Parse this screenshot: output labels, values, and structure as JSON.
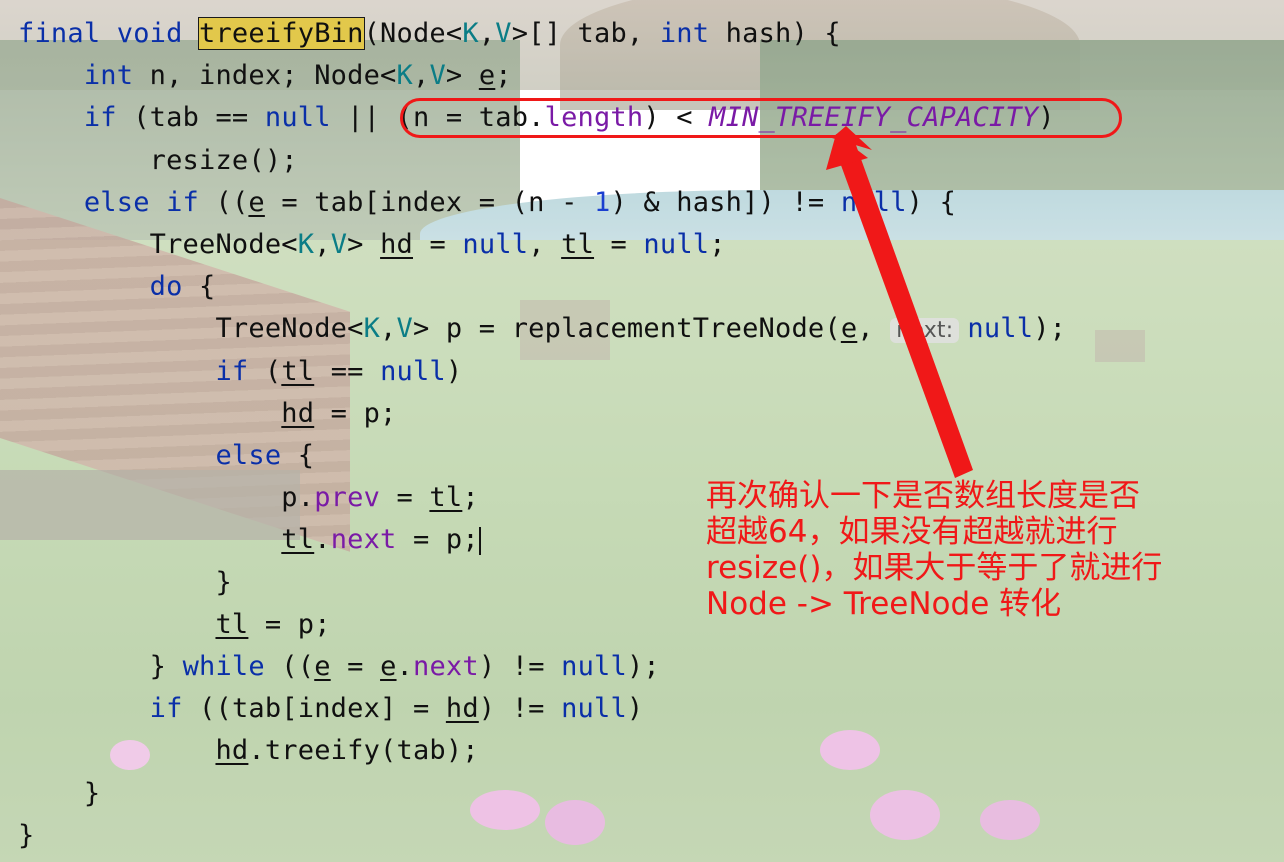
{
  "code": {
    "lines": [
      {
        "segments": [
          {
            "t": "final ",
            "c": "kw"
          },
          {
            "t": "void ",
            "c": "kw"
          },
          {
            "t": "treeifyBin",
            "c": "hl"
          },
          {
            "t": "(Node<"
          },
          {
            "t": "K",
            "c": "tp"
          },
          {
            "t": ","
          },
          {
            "t": "V",
            "c": "tp"
          },
          {
            "t": ">[] tab, "
          },
          {
            "t": "int ",
            "c": "kw"
          },
          {
            "t": "hash) {"
          }
        ]
      },
      {
        "segments": [
          {
            "t": "    "
          },
          {
            "t": "int ",
            "c": "kw"
          },
          {
            "t": "n, index; Node<"
          },
          {
            "t": "K",
            "c": "tp"
          },
          {
            "t": ","
          },
          {
            "t": "V",
            "c": "tp"
          },
          {
            "t": "> "
          },
          {
            "t": "e",
            "c": "ul"
          },
          {
            "t": ";"
          }
        ]
      },
      {
        "segments": [
          {
            "t": "    "
          },
          {
            "t": "if ",
            "c": "kw"
          },
          {
            "t": "(tab == "
          },
          {
            "t": "null ",
            "c": "kw"
          },
          {
            "t": "|| (n = tab."
          },
          {
            "t": "length",
            "c": "fld"
          },
          {
            "t": ") < "
          },
          {
            "t": "MIN_TREEIFY_CAPACITY",
            "c": "cst"
          },
          {
            "t": ")"
          }
        ]
      },
      {
        "segments": [
          {
            "t": "        resize();"
          }
        ]
      },
      {
        "segments": [
          {
            "t": "    "
          },
          {
            "t": "else if ",
            "c": "kw"
          },
          {
            "t": "(("
          },
          {
            "t": "e",
            "c": "ul"
          },
          {
            "t": " = tab[index = (n - "
          },
          {
            "t": "1",
            "c": "num"
          },
          {
            "t": ") & hash]) != "
          },
          {
            "t": "null",
            "c": "kw"
          },
          {
            "t": ") {"
          }
        ]
      },
      {
        "segments": [
          {
            "t": "        TreeNode<"
          },
          {
            "t": "K",
            "c": "tp"
          },
          {
            "t": ","
          },
          {
            "t": "V",
            "c": "tp"
          },
          {
            "t": "> "
          },
          {
            "t": "hd",
            "c": "ul"
          },
          {
            "t": " = "
          },
          {
            "t": "null",
            "c": "kw"
          },
          {
            "t": ", "
          },
          {
            "t": "tl",
            "c": "ul"
          },
          {
            "t": " = "
          },
          {
            "t": "null",
            "c": "kw"
          },
          {
            "t": ";"
          }
        ]
      },
      {
        "segments": [
          {
            "t": "        "
          },
          {
            "t": "do ",
            "c": "kw"
          },
          {
            "t": "{"
          }
        ]
      },
      {
        "segments": [
          {
            "t": "            TreeNode<"
          },
          {
            "t": "K",
            "c": "tp"
          },
          {
            "t": ","
          },
          {
            "t": "V",
            "c": "tp"
          },
          {
            "t": "> p = replacementTreeNode("
          },
          {
            "t": "e",
            "c": "ul"
          },
          {
            "t": ", "
          },
          {
            "t": "next:",
            "c": "hint"
          },
          {
            "t": "null",
            "c": "kw"
          },
          {
            "t": ");"
          }
        ]
      },
      {
        "segments": [
          {
            "t": "            "
          },
          {
            "t": "if ",
            "c": "kw"
          },
          {
            "t": "("
          },
          {
            "t": "tl",
            "c": "ul"
          },
          {
            "t": " == "
          },
          {
            "t": "null",
            "c": "kw"
          },
          {
            "t": ")"
          }
        ]
      },
      {
        "segments": [
          {
            "t": "                "
          },
          {
            "t": "hd",
            "c": "ul"
          },
          {
            "t": " = p;"
          }
        ]
      },
      {
        "segments": [
          {
            "t": "            "
          },
          {
            "t": "else ",
            "c": "kw"
          },
          {
            "t": "{"
          }
        ]
      },
      {
        "segments": [
          {
            "t": "                p."
          },
          {
            "t": "prev",
            "c": "fld"
          },
          {
            "t": " = "
          },
          {
            "t": "tl",
            "c": "ul"
          },
          {
            "t": ";"
          }
        ]
      },
      {
        "segments": [
          {
            "t": "                "
          },
          {
            "t": "tl",
            "c": "ul"
          },
          {
            "t": "."
          },
          {
            "t": "next",
            "c": "fld"
          },
          {
            "t": " = p;"
          },
          {
            "t": "",
            "c": "caret"
          }
        ]
      },
      {
        "segments": [
          {
            "t": "            }"
          }
        ]
      },
      {
        "segments": [
          {
            "t": "            "
          },
          {
            "t": "tl",
            "c": "ul"
          },
          {
            "t": " = p;"
          }
        ]
      },
      {
        "segments": [
          {
            "t": "        } "
          },
          {
            "t": "while ",
            "c": "kw"
          },
          {
            "t": "(("
          },
          {
            "t": "e",
            "c": "ul"
          },
          {
            "t": " = "
          },
          {
            "t": "e",
            "c": "ul"
          },
          {
            "t": "."
          },
          {
            "t": "next",
            "c": "fld"
          },
          {
            "t": ") != "
          },
          {
            "t": "null",
            "c": "kw"
          },
          {
            "t": ");"
          }
        ]
      },
      {
        "segments": [
          {
            "t": "        "
          },
          {
            "t": "if ",
            "c": "kw"
          },
          {
            "t": "((tab[index] = "
          },
          {
            "t": "hd",
            "c": "ul"
          },
          {
            "t": ") != "
          },
          {
            "t": "null",
            "c": "kw"
          },
          {
            "t": ")"
          }
        ]
      },
      {
        "segments": [
          {
            "t": "            "
          },
          {
            "t": "hd",
            "c": "ul"
          },
          {
            "t": ".treeify(tab);"
          }
        ]
      },
      {
        "segments": [
          {
            "t": "    }"
          }
        ]
      },
      {
        "segments": [
          {
            "t": "}"
          }
        ]
      }
    ]
  },
  "annotation": {
    "lines": [
      "再次确认一下是否数组长度是否",
      "超越64，如果没有超越就进行",
      "resize()，如果大于等于了就进行",
      "Node -> TreeNode 转化"
    ],
    "color": "#f01818"
  },
  "colors": {
    "keyword": "#0a2fa8",
    "type_param": "#0b7d86",
    "field": "#7a1aa6",
    "highlight": "#e2c84b"
  }
}
